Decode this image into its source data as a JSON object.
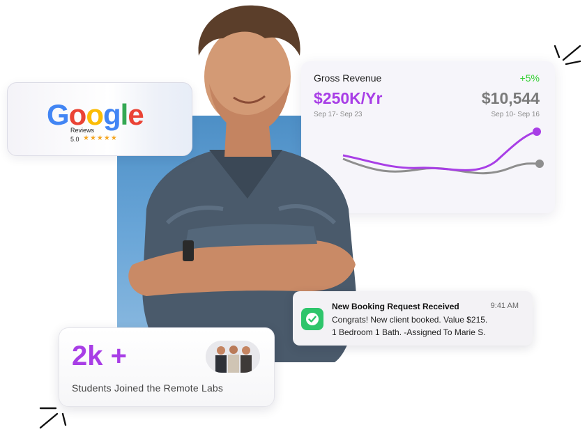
{
  "revenue": {
    "title": "Gross Revenue",
    "change": "+5%",
    "main_value": "$250K/Yr",
    "side_value": "$10,544",
    "date_left": "Sep 17- Sep 23",
    "date_right": "Sep 10- Sep 16",
    "colors": {
      "primary": "#a83ee6",
      "secondary": "#8e8e8e",
      "change": "#2fcf2f"
    }
  },
  "google": {
    "logo_text": "Google",
    "subtitle": "Reviews",
    "rating": "5.0",
    "stars": "★★★★★"
  },
  "booking": {
    "title": "New Booking Request Received",
    "time": "9:41 AM",
    "line1": "Congrats! New client booked. Value $215.",
    "line2": "1 Bedroom 1 Bath.  -Assigned To Marie S.",
    "icon": "check-icon"
  },
  "students": {
    "count": "2k +",
    "label": "Students Joined the Remote  Labs"
  }
}
